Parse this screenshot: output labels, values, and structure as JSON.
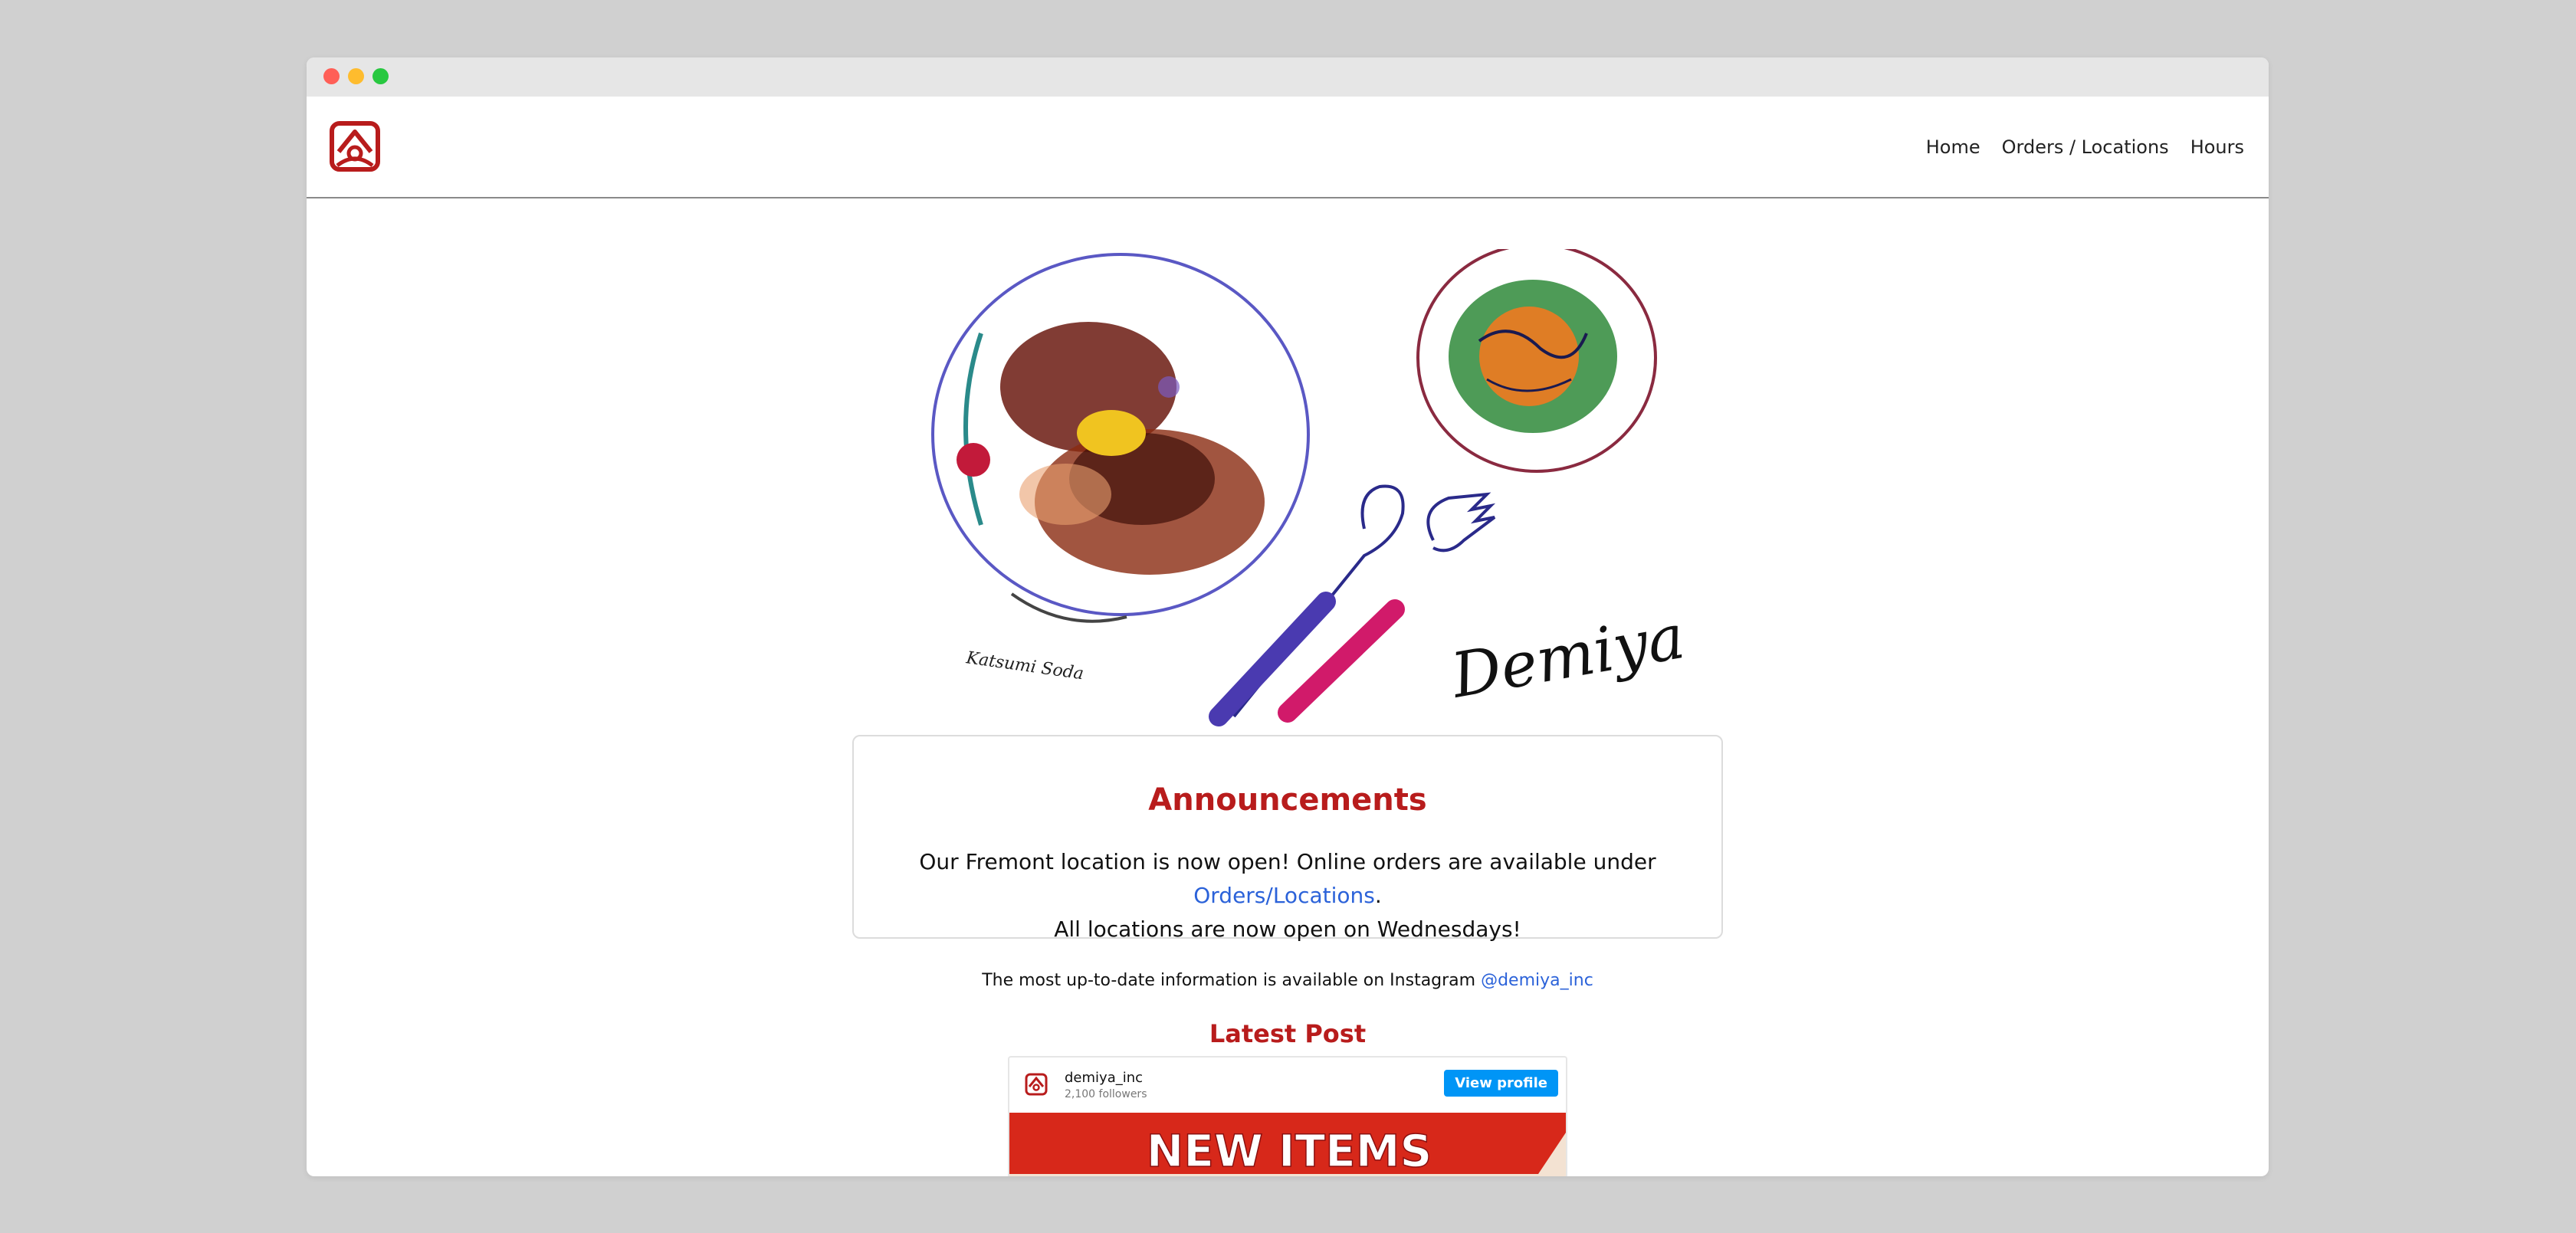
{
  "nav": {
    "items": [
      {
        "label": "Home"
      },
      {
        "label": "Orders / Locations"
      },
      {
        "label": "Hours"
      }
    ]
  },
  "hero": {
    "signature": "Demiya",
    "artist_signature": "Katsumi Soda"
  },
  "announcements": {
    "title": "Announcements",
    "line1_prefix": "Our Fremont location is now open! Online orders are available under ",
    "line1_link": "Orders/Locations",
    "line1_suffix": ".",
    "line2": "All locations are now open on Wednesdays!"
  },
  "instagram_note": {
    "text": "The most up-to-date information is available on Instagram ",
    "handle": "@demiya_inc"
  },
  "latest_post": {
    "title": "Latest Post",
    "username": "demiya_inc",
    "followers": "2,100 followers",
    "button_label": "View profile",
    "image_text": "NEW ITEMS"
  },
  "colors": {
    "brand_red": "#b81c1c",
    "link_blue": "#2b62d9",
    "instagram_blue": "#0095f6"
  }
}
